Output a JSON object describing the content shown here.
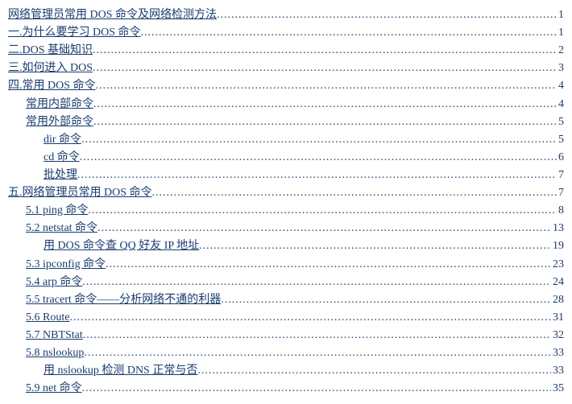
{
  "toc": [
    {
      "title": "网络管理员常用 DOS 命令及网络检测方法",
      "page": "1",
      "indent": 0
    },
    {
      "title": "一.为什么要学习 DOS 命令",
      "page": "1",
      "indent": 0
    },
    {
      "title": "二.DOS 基础知识",
      "page": "2",
      "indent": 0
    },
    {
      "title": "三.如何进入 DOS",
      "page": "3",
      "indent": 0
    },
    {
      "title": "四.常用 DOS 命令",
      "page": "4",
      "indent": 0
    },
    {
      "title": "常用内部命令",
      "page": "4",
      "indent": 1
    },
    {
      "title": "常用外部命令",
      "page": "5",
      "indent": 1
    },
    {
      "title": "dir 命令",
      "page": "5",
      "indent": 2
    },
    {
      "title": "cd 命令",
      "page": "6",
      "indent": 2
    },
    {
      "title": "批处理",
      "page": "7",
      "indent": 2
    },
    {
      "title": "五.网络管理员常用 DOS 命令",
      "page": "7",
      "indent": 0
    },
    {
      "title": "5.1 ping 命令",
      "page": "8",
      "indent": 1
    },
    {
      "title": "5.2 netstat 命令",
      "page": "13",
      "indent": 1
    },
    {
      "title": "用 DOS 命令查 QQ 好友 IP 地址",
      "page": "19",
      "indent": 2
    },
    {
      "title": "5.3 ipconfig 命令",
      "page": "23",
      "indent": 1
    },
    {
      "title": "5.4 arp 命令",
      "page": "24",
      "indent": 1
    },
    {
      "title": "5.5 tracert 命令——分析网络不通的利器",
      "page": "28",
      "indent": 1
    },
    {
      "title": "5.6 Route",
      "page": "31",
      "indent": 1
    },
    {
      "title": "5.7 NBTStat",
      "page": "32",
      "indent": 1
    },
    {
      "title": "5.8 nslookup",
      "page": "33",
      "indent": 1
    },
    {
      "title": "用 nslookup 检测 DNS 正常与否",
      "page": "33",
      "indent": 2
    },
    {
      "title": "5.9 net 命令",
      "page": "35",
      "indent": 1
    }
  ]
}
